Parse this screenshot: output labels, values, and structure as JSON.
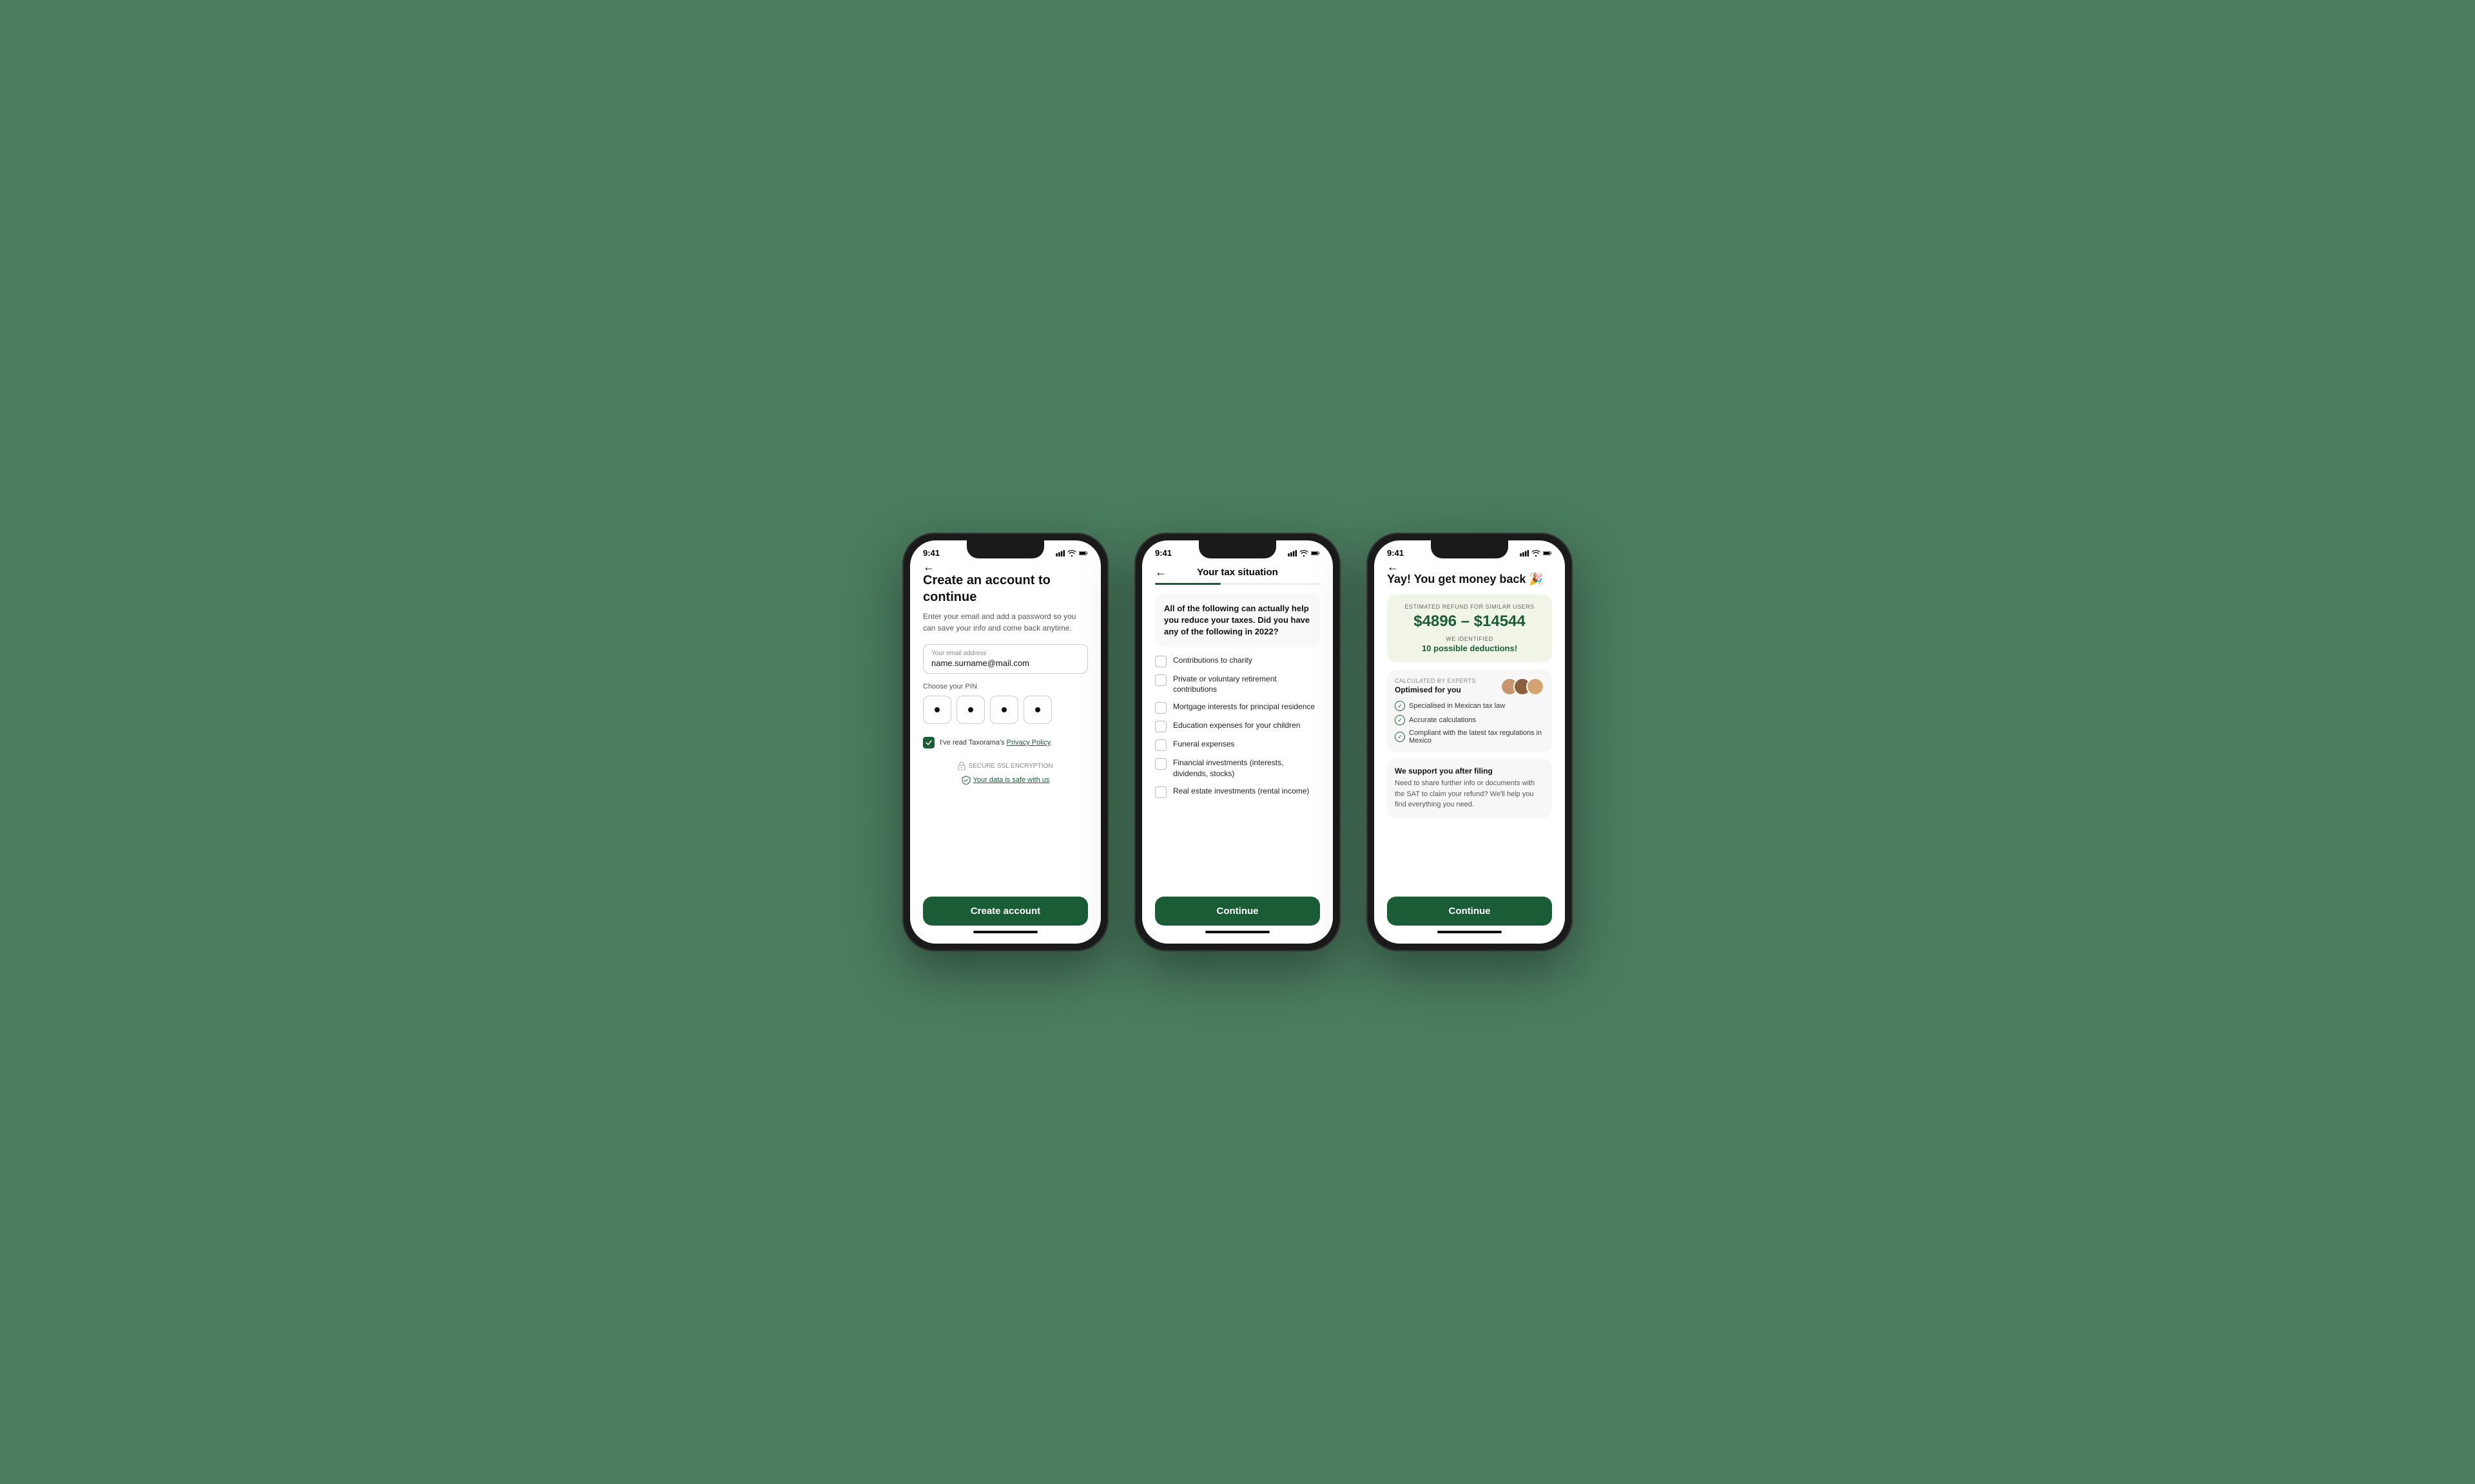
{
  "background_color": "#4a7c5f",
  "phones": [
    {
      "id": "phone-create-account",
      "status_bar": {
        "time": "9:41",
        "icons": [
          "signal",
          "wifi",
          "battery"
        ]
      },
      "nav": {
        "back_label": "←",
        "title": ""
      },
      "heading": "Create an account to continue",
      "subtext": "Enter your email and add a password so you can save your info and come back anytime.",
      "email_input": {
        "label": "Your email address",
        "value": "name.surname@mail.com"
      },
      "pin_section": {
        "label": "Choose your PIN",
        "dots": 4
      },
      "checkbox": {
        "checked": true,
        "label": "I've read Taxorama's ",
        "link_text": "Privacy Policy",
        "period": "."
      },
      "secure": {
        "badge_text": "SECURE SSL ENCRYPTION",
        "data_safe_text": "Your data is safe with us"
      },
      "cta": "Create account"
    },
    {
      "id": "phone-tax-situation",
      "status_bar": {
        "time": "9:41",
        "icons": [
          "signal",
          "wifi",
          "battery"
        ]
      },
      "nav": {
        "back_label": "←",
        "title": "Your tax situation"
      },
      "progress": 40,
      "question": "All of the following can actually help you reduce your taxes. Did you have any of the following in 2022?",
      "checklist": [
        {
          "label": "Contributions to charity",
          "checked": false
        },
        {
          "label": "Private or voluntary retirement contributions",
          "checked": false
        },
        {
          "label": "Mortgage interests for principal residence",
          "checked": false
        },
        {
          "label": "Education expenses for your children",
          "checked": false
        },
        {
          "label": "Funeral expenses",
          "checked": false
        },
        {
          "label": "Financial investments (interests, dividends, stocks)",
          "checked": false
        },
        {
          "label": "Real estate investments (rental income)",
          "checked": false
        }
      ],
      "cta": "Continue"
    },
    {
      "id": "phone-results",
      "status_bar": {
        "time": "9:41",
        "icons": [
          "signal",
          "wifi",
          "battery"
        ]
      },
      "nav": {
        "back_label": "←",
        "title": ""
      },
      "result_heading": "Yay! You get money back 🎉",
      "refund_card": {
        "label": "ESTIMATED REFUND FOR SIMILAR USERS",
        "amount": "$4896 – $14544",
        "deductions_label": "WE IDENTIFIED",
        "deductions_value": "10 possible deductions!"
      },
      "experts_card": {
        "meta": "CALCULATED BY EXPERTS",
        "title": "Optimised for you",
        "features": [
          "Specialised in Mexican tax law",
          "Accurate calculations",
          "Compliant with the latest tax regulations in Mexico"
        ]
      },
      "support_card": {
        "title": "We support you after filing",
        "text": "Need to share further info or documents with the SAT to claim your refund? We'll help you find everything you need."
      },
      "cta": "Continue"
    }
  ]
}
